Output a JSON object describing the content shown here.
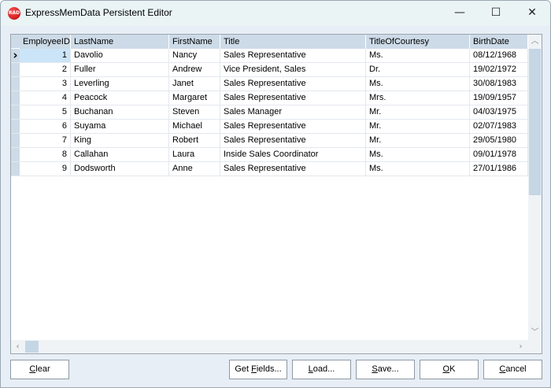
{
  "window": {
    "title": "ExpressMemData Persistent Editor",
    "icon_text": "RAD",
    "minimize": "—",
    "maximize": "☐",
    "close": "✕"
  },
  "grid": {
    "columns": [
      "EmployeeID",
      "LastName",
      "FirstName",
      "Title",
      "TitleOfCourtesy",
      "BirthDate"
    ],
    "rows": [
      [
        "1",
        "Davolio",
        "Nancy",
        "Sales Representative",
        "Ms.",
        "08/12/1968"
      ],
      [
        "2",
        "Fuller",
        "Andrew",
        "Vice President, Sales",
        "Dr.",
        "19/02/1972"
      ],
      [
        "3",
        "Leverling",
        "Janet",
        "Sales Representative",
        "Ms.",
        "30/08/1983"
      ],
      [
        "4",
        "Peacock",
        "Margaret",
        "Sales Representative",
        "Mrs.",
        "19/09/1957"
      ],
      [
        "5",
        "Buchanan",
        "Steven",
        "Sales Manager",
        "Mr.",
        "04/03/1975"
      ],
      [
        "6",
        "Suyama",
        "Michael",
        "Sales Representative",
        "Mr.",
        "02/07/1983"
      ],
      [
        "7",
        "King",
        "Robert",
        "Sales Representative",
        "Mr.",
        "29/05/1980"
      ],
      [
        "8",
        "Callahan",
        "Laura",
        "Inside Sales Coordinator",
        "Ms.",
        "09/01/1978"
      ],
      [
        "9",
        "Dodsworth",
        "Anne",
        "Sales Representative",
        "Ms.",
        "27/01/1986"
      ]
    ],
    "current_row_indicator": "›"
  },
  "buttons": {
    "clear": {
      "pre": "",
      "key": "C",
      "post": "lear"
    },
    "get_fields": {
      "pre": "Get ",
      "key": "F",
      "post": "ields..."
    },
    "load": {
      "pre": "",
      "key": "L",
      "post": "oad..."
    },
    "save": {
      "pre": "",
      "key": "S",
      "post": "ave..."
    },
    "ok": {
      "pre": "",
      "key": "O",
      "post": "K"
    },
    "cancel": {
      "pre": "",
      "key": "C",
      "post": "ancel"
    }
  }
}
